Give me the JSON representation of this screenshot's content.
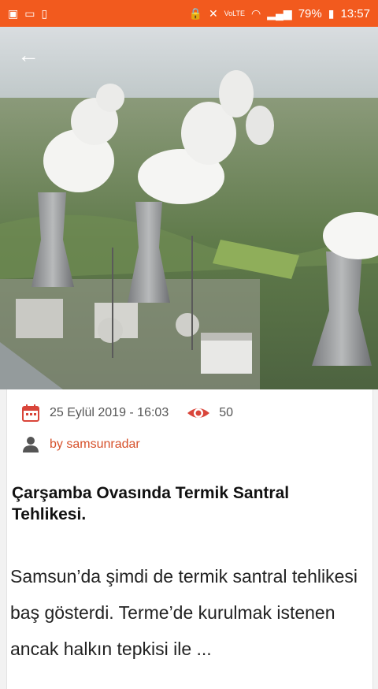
{
  "status_bar": {
    "battery": "79%",
    "time": "13:57",
    "network": "VoLTE"
  },
  "hero": {
    "image_description_icon": "power-plant-photo"
  },
  "article": {
    "date": "25 Eylül 2019 - 16:03",
    "views": "50",
    "author": "by samsunradar",
    "title": "Çarşamba Ovasında Termik Santral Tehlikesi.",
    "body": "Samsun’da şimdi de termik santral tehlikesi baş gösterdi. Terme’de kurulmak istenen ancak halkın tepkisi ile ..."
  },
  "colors": {
    "accent": "#f25a1e",
    "icon_red": "#d9453a"
  }
}
